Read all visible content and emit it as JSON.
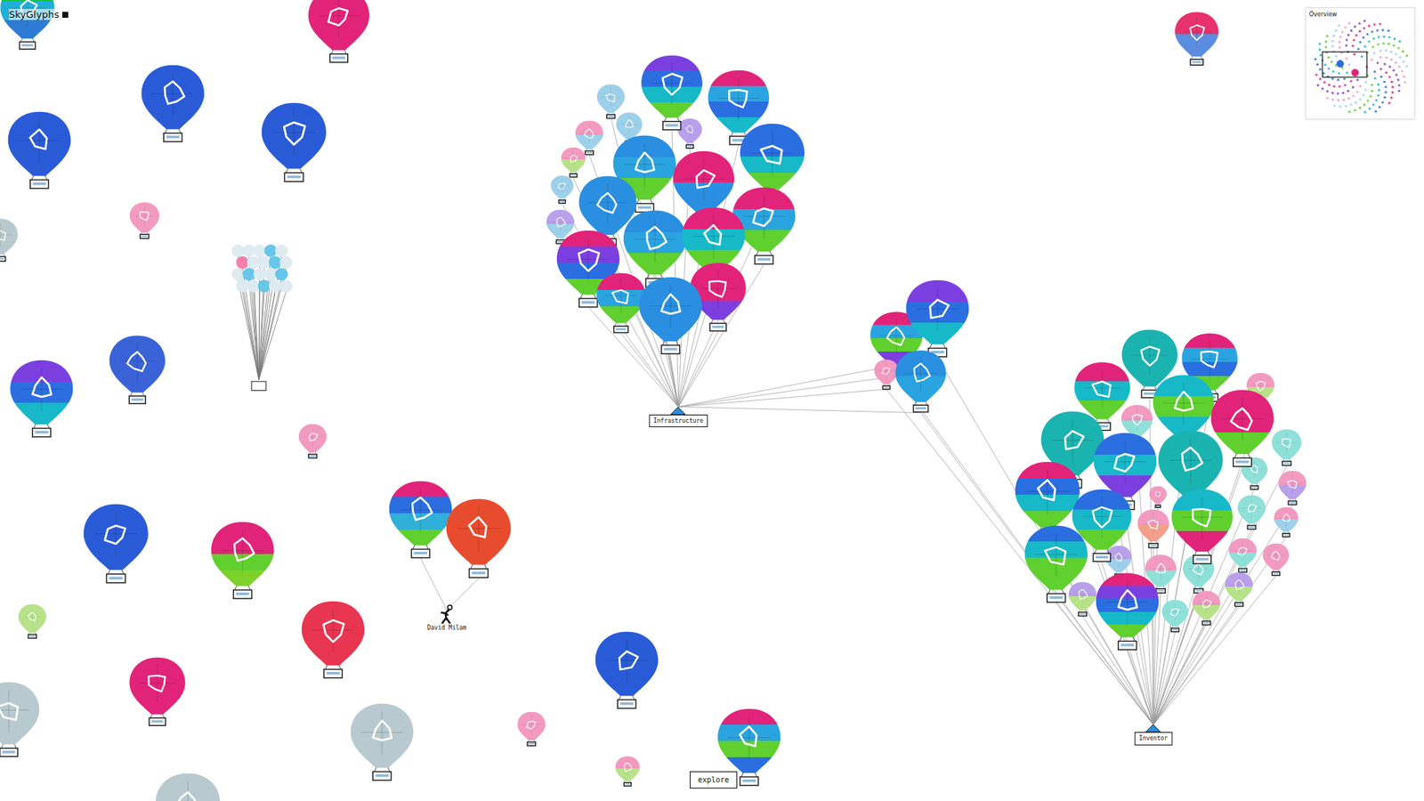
{
  "app": {
    "title": "SkyGlyphs"
  },
  "overview": {
    "title": "Overview"
  },
  "explore_button": {
    "label": "explore"
  },
  "free_balloons": [
    {
      "bands": [
        "#18c24a",
        "#1fb0d8",
        "#2e7bd6"
      ]
    },
    {
      "bands": [
        "#e2237a"
      ]
    },
    {
      "bands": [
        "#2a5bd7"
      ]
    },
    {
      "bands": [
        "#2a5bd7"
      ]
    },
    {
      "bands": [
        "#2a5bd7"
      ]
    },
    {
      "bands": [
        "#f29ac0"
      ]
    },
    {
      "bands": [
        "#b8c9cf"
      ]
    },
    {
      "bands": [
        "#7b3fe0",
        "#2c6ee0",
        "#17b8c8"
      ]
    },
    {
      "bands": [
        "#3a63d8"
      ]
    },
    {
      "bands": [
        "#f29ac0"
      ]
    },
    {
      "bands": [
        "#2a5bd7"
      ]
    },
    {
      "bands": [
        "#e2237a",
        "#e2237a",
        "#5fd02e",
        "#7fd22a"
      ]
    },
    {
      "bands": [
        "#b8e28a"
      ]
    },
    {
      "bands": [
        "#e83550"
      ]
    },
    {
      "bands": [
        "#e2237a"
      ]
    },
    {
      "bands": [
        "#b8c9cf"
      ]
    },
    {
      "bands": [
        "#b8c9cf"
      ]
    },
    {
      "bands": [
        "#b8c9cf"
      ]
    },
    {
      "bands": [
        "#2a5bd7"
      ]
    },
    {
      "bands": [
        "#f29ac0"
      ]
    },
    {
      "bands": [
        "#f29ac0",
        "#b8e28a"
      ]
    },
    {
      "bands": [
        "#e2237a",
        "#2aa4e0",
        "#5fd02e",
        "#2a6ee0"
      ]
    },
    {
      "bands": [
        "#e8326d",
        "#5a8de0"
      ]
    }
  ],
  "clusters": [
    {
      "label": "Infrastructure",
      "balloons": [
        {
          "bands": [
            "#9dd0ea"
          ]
        },
        {
          "bands": [
            "#9dd0ea"
          ]
        },
        {
          "bands": [
            "#f29ac0",
            "#9dd0ea"
          ]
        },
        {
          "bands": [
            "#f29ac0",
            "#b8e28a"
          ]
        },
        {
          "bands": [
            "#9dd0ea"
          ]
        },
        {
          "bands": [
            "#b9a0ea",
            "#9dd0ea"
          ]
        },
        {
          "bands": [
            "#b9a0ea"
          ]
        },
        {
          "bands": [
            "#7b3fe0",
            "#2c6ee0",
            "#17b8c8",
            "#5fd02e"
          ]
        },
        {
          "bands": [
            "#e2237a",
            "#2aa4e0",
            "#2a6ee0",
            "#17b8c8"
          ]
        },
        {
          "bands": [
            "#2a6ee0",
            "#2a6ee0",
            "#17b8c8",
            "#5fd02e"
          ]
        },
        {
          "bands": [
            "#2a8fe0",
            "#2aa4e0",
            "#5fd02e"
          ]
        },
        {
          "bands": [
            "#2a8fe0"
          ]
        },
        {
          "bands": [
            "#e2237a",
            "#2a8fe0"
          ]
        },
        {
          "bands": [
            "#e2237a",
            "#2aa4e0",
            "#5fd02e"
          ]
        },
        {
          "bands": [
            "#2a8fe0",
            "#2aa4e0",
            "#5fd02e"
          ]
        },
        {
          "bands": [
            "#e2237a",
            "#17b8c8",
            "#5fd02e"
          ]
        },
        {
          "bands": [
            "#e2237a",
            "#7b3fe0",
            "#2a6ee0",
            "#5fd02e"
          ]
        },
        {
          "bands": [
            "#e2237a",
            "#e2237a",
            "#7b3fe0"
          ]
        },
        {
          "bands": [
            "#e2237a",
            "#2aa4e0",
            "#5fd02e"
          ]
        },
        {
          "bands": [
            "#2a8fe0"
          ]
        }
      ]
    },
    {
      "label": "Inventor",
      "balloons": [
        {
          "bands": [
            "#f29ac0",
            "#b8e28a"
          ]
        },
        {
          "bands": [
            "#8ee0d8"
          ]
        },
        {
          "bands": [
            "#f29ac0",
            "#b9a0ea"
          ]
        },
        {
          "bands": [
            "#f29ac0",
            "#9dd0ea"
          ]
        },
        {
          "bands": [
            "#f29ac0"
          ]
        },
        {
          "bands": [
            "#8ee0d8"
          ]
        },
        {
          "bands": [
            "#f29ac0",
            "#8ee0d8"
          ]
        },
        {
          "bands": [
            "#b9a0ea",
            "#b8e28a"
          ]
        },
        {
          "bands": [
            "#8ee0d8"
          ]
        },
        {
          "bands": [
            "#f29ac0",
            "#8ee0d8"
          ]
        },
        {
          "bands": [
            "#f29ac0"
          ]
        },
        {
          "bands": [
            "#f29ac0",
            "#f2a08a"
          ]
        },
        {
          "bands": [
            "#f29ac0",
            "#8ee0d8"
          ]
        },
        {
          "bands": [
            "#8ee0d8"
          ]
        },
        {
          "bands": [
            "#f29ac0",
            "#b8e28a"
          ]
        },
        {
          "bands": [
            "#8ee0d8"
          ]
        },
        {
          "bands": [
            "#b9a0ea",
            "#b8e28a"
          ]
        },
        {
          "bands": [
            "#b9a0ea",
            "#9dd0ea"
          ]
        },
        {
          "bands": [
            "#1bb3b0"
          ]
        },
        {
          "bands": [
            "#e2237a",
            "#2aa4e0",
            "#2a6ee0",
            "#5fd02e"
          ]
        },
        {
          "bands": [
            "#e2237a",
            "#17b8c8",
            "#5fd02e"
          ]
        },
        {
          "bands": [
            "#17b8c8",
            "#5fd02e",
            "#17b8c8"
          ]
        },
        {
          "bands": [
            "#e2237a",
            "#e2237a",
            "#5fd02e"
          ]
        },
        {
          "bands": [
            "#1bb3b0"
          ]
        },
        {
          "bands": [
            "#2a6ee0",
            "#17b8c8",
            "#7b3fe0"
          ]
        },
        {
          "bands": [
            "#1bb3b0"
          ]
        },
        {
          "bands": [
            "#e2237a",
            "#2a6ee0",
            "#17b8c8",
            "#5fd02e"
          ]
        },
        {
          "bands": [
            "#2a6ee0",
            "#17b8c8",
            "#5fd02e"
          ]
        },
        {
          "bands": [
            "#17b8c8",
            "#5fd02e",
            "#e2237a"
          ]
        },
        {
          "bands": [
            "#2a6ee0",
            "#17b8c8",
            "#5fd02e",
            "#5fd02e"
          ]
        },
        {
          "bands": [
            "#e2237a",
            "#7b3fe0",
            "#2a6ee0",
            "#17b8c8",
            "#5fd02e"
          ]
        }
      ]
    },
    {
      "label": "David Milam",
      "balloons": [
        {
          "bands": [
            "#e2237a",
            "#2a6ee0",
            "#2fb0d8",
            "#5fd02e"
          ]
        },
        {
          "bands": [
            "#e84c2e"
          ]
        }
      ]
    }
  ],
  "shared_balloons": [
    {
      "bands": [
        "#e2237a",
        "#2aa4e0",
        "#5fd02e",
        "#7b3fe0"
      ]
    },
    {
      "bands": [
        "#7b3fe0",
        "#2a6ee0",
        "#17b8c8"
      ]
    },
    {
      "bands": [
        "#f29ac0"
      ]
    },
    {
      "bands": [
        "#2a8fe0",
        "#2aa4e0"
      ]
    }
  ],
  "small_bunch": {
    "bands": [
      "#dcebf0",
      "#dcebf0",
      "#dcebf0",
      "#5fc4e8",
      "#dcebf0",
      "#f27aa8",
      "#dcebf0",
      "#dcebf0",
      "#5fc4e8",
      "#dcebf0",
      "#dcebf0",
      "#5fc4e8",
      "#dcebf0",
      "#dcebf0",
      "#5fc4e8",
      "#dcebf0",
      "#dcebf0",
      "#5fc4e8",
      "#dcebf0",
      "#dcebf0"
    ]
  }
}
